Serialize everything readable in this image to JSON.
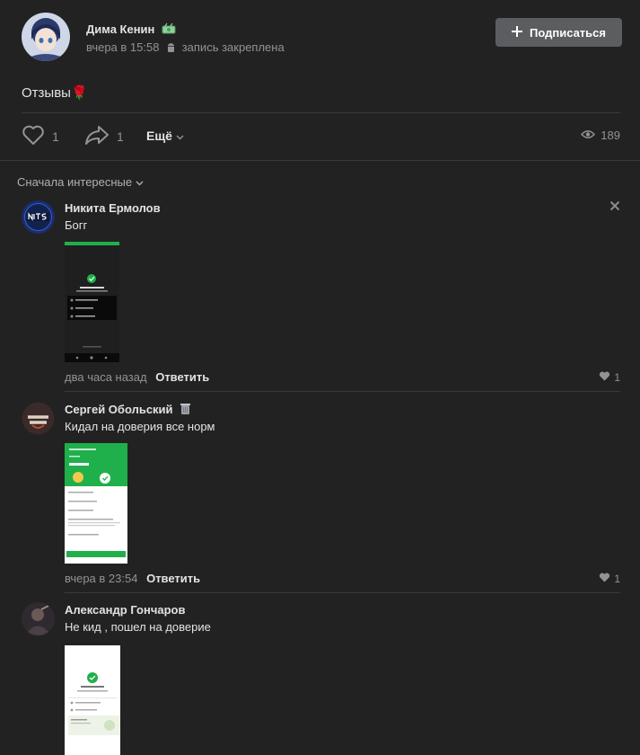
{
  "post": {
    "author": "Дима Кенин",
    "badge_icon": "money-emoji-icon",
    "time": "вчера в 15:58",
    "platform_icon": "android-icon",
    "pinned": "запись закреплена",
    "subscribe_label": "Подписаться",
    "text": "Отзывы🌹",
    "likes": "1",
    "shares": "1",
    "more_label": "Ещё",
    "views": "189"
  },
  "comments_sort": "Сначала интересные",
  "comments": [
    {
      "author": "Никита Ермолов",
      "text": "Богг",
      "time": "два часа назад",
      "reply": "Ответить",
      "likes": "1"
    },
    {
      "author": "Сергей Обольский",
      "badge_icon": "trash-emoji-icon",
      "text": "Кидал на доверия все норм",
      "time": "вчера в 23:54",
      "reply": "Ответить",
      "likes": "1"
    },
    {
      "author": "Александр Гончаров",
      "text": "Не кид , пошел на доверие"
    }
  ],
  "colors": {
    "background": "#222222",
    "text": "#e1e3e6",
    "muted": "#939393",
    "button": "#5c5d60",
    "green": "#20b04b"
  }
}
